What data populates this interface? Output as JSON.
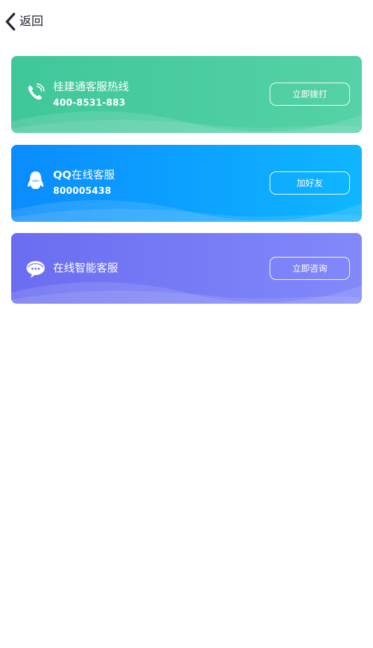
{
  "header": {
    "back_label": "返回"
  },
  "cards": [
    {
      "title": "桂建通客服热线",
      "subtitle": "400-8531-883",
      "action_label": "立即拨打",
      "icon": "phone-icon",
      "color_start": "#3fc79a",
      "color_end": "#55d2a6"
    },
    {
      "title_bold": "QQ",
      "title": "在线客服",
      "subtitle": "800005438",
      "action_label": "加好友",
      "icon": "qq-penguin-icon",
      "color_start": "#0a8cff",
      "color_end": "#0fb6ff"
    },
    {
      "title": "在线智能客服",
      "action_label": "立即咨询",
      "icon": "chat-bubble-icon",
      "color_start": "#6a6df0",
      "color_end": "#8289fa"
    }
  ]
}
